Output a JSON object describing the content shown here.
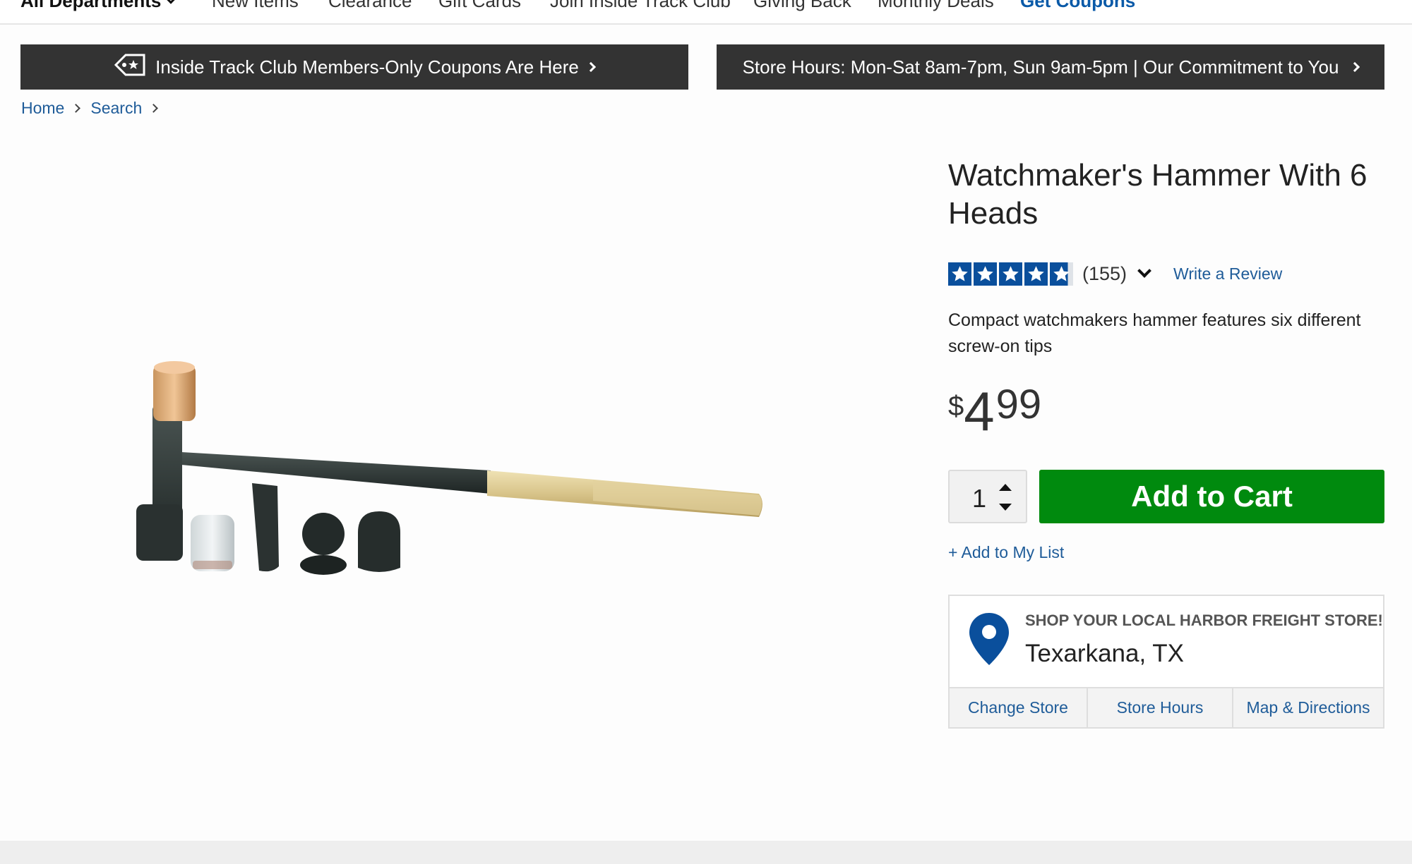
{
  "nav": {
    "departments": "All Departments",
    "items": [
      "New Items",
      "Clearance",
      "Gift Cards",
      "Join Inside Track Club",
      "Giving Back",
      "Monthly Deals"
    ],
    "coupons": "Get Coupons"
  },
  "banners": {
    "left": "Inside Track Club Members-Only Coupons Are Here",
    "right": "Store Hours: Mon-Sat 8am-7pm, Sun 9am-5pm | Our Commitment to You"
  },
  "breadcrumb": [
    "Home",
    "Search"
  ],
  "product": {
    "title": "Watchmaker's Hammer With 6 Heads",
    "rating_stars": 4.5,
    "review_count": "(155)",
    "write_review": "Write a Review",
    "description": "Compact watchmakers hammer features six different screw-on tips",
    "price_currency": "$",
    "price_dollars": "4",
    "price_cents": "99",
    "quantity": "1",
    "add_to_cart": "Add to Cart",
    "add_to_list": "+ Add to My List"
  },
  "store": {
    "heading": "SHOP YOUR LOCAL HARBOR FREIGHT STORE!",
    "city": "Texarkana, TX",
    "links": [
      "Change Store",
      "Store Hours",
      "Map & Directions"
    ]
  },
  "colors": {
    "brand_blue": "#0a4f9c",
    "link_blue": "#1f5c99",
    "cart_green": "#008a0e",
    "banner_dark": "#333333"
  }
}
